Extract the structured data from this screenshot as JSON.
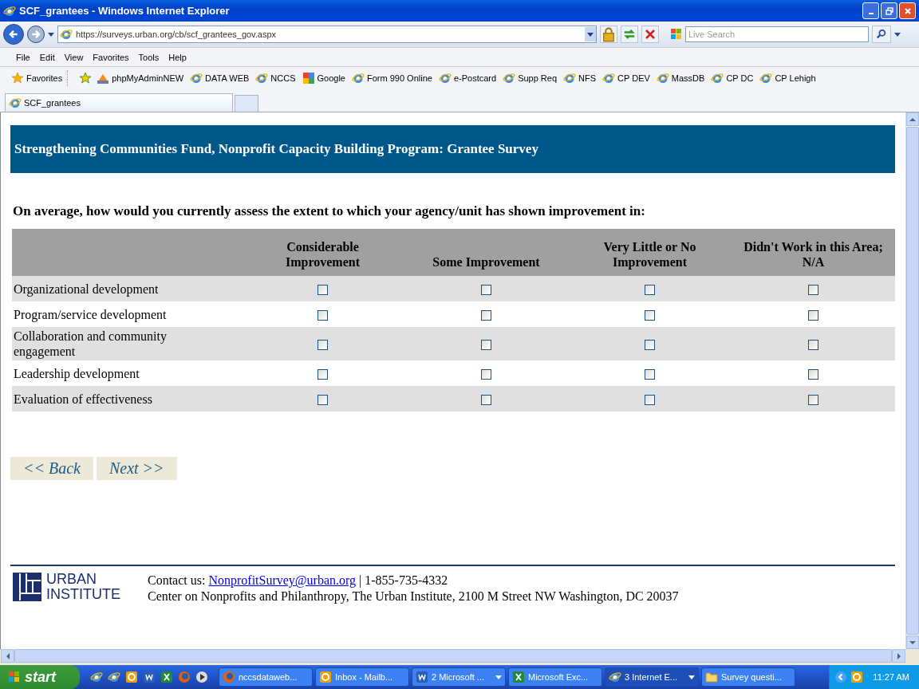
{
  "window": {
    "title": "SCF_grantees - Windows Internet Explorer"
  },
  "address_bar": {
    "url": "https://surveys.urban.org/cb/scf_grantees_gov.aspx"
  },
  "search": {
    "placeholder": "Live Search"
  },
  "menu": [
    "File",
    "Edit",
    "View",
    "Favorites",
    "Tools",
    "Help"
  ],
  "favorites_bar": {
    "label": "Favorites",
    "links": [
      {
        "label": "phpMyAdminNEW",
        "kind": "pma"
      },
      {
        "label": "DATA WEB",
        "kind": "ie"
      },
      {
        "label": "NCCS",
        "kind": "ie"
      },
      {
        "label": "Google",
        "kind": "google"
      },
      {
        "label": "Form 990 Online",
        "kind": "ie"
      },
      {
        "label": "e-Postcard",
        "kind": "ie"
      },
      {
        "label": "Supp Req",
        "kind": "ie"
      },
      {
        "label": "NFS",
        "kind": "ie"
      },
      {
        "label": "CP DEV",
        "kind": "ie"
      },
      {
        "label": "MassDB",
        "kind": "ie"
      },
      {
        "label": "CP DC",
        "kind": "ie"
      },
      {
        "label": "CP Lehigh",
        "kind": "ie"
      }
    ]
  },
  "tabs": [
    {
      "label": "SCF_grantees",
      "selected": true
    }
  ],
  "page": {
    "header": "Strengthening Communities Fund, Nonprofit Capacity Building Program: Grantee Survey",
    "question": "On average, how would you currently assess the extent to which your agency/unit has shown improvement in:",
    "columns": [
      "Considerable Improvement",
      "Some Improvement",
      "Very Little or No Improvement",
      "Didn't Work in this Area; N/A"
    ],
    "rows": [
      {
        "label": "Organizational development",
        "answers": [
          {
            "checked": false
          },
          {
            "checked": false
          },
          {
            "checked": false
          },
          {
            "checked": false
          }
        ]
      },
      {
        "label": "Program/service development",
        "answers": [
          {
            "checked": false
          },
          {
            "checked": false
          },
          {
            "checked": false
          },
          {
            "checked": false
          }
        ]
      },
      {
        "label": "Collaboration and community engagement",
        "answers": [
          {
            "checked": false
          },
          {
            "checked": false
          },
          {
            "checked": false
          },
          {
            "checked": false
          }
        ]
      },
      {
        "label": "Leadership development",
        "answers": [
          {
            "checked": false
          },
          {
            "checked": false
          },
          {
            "checked": false
          },
          {
            "checked": false
          }
        ]
      },
      {
        "label": "Evaluation of effectiveness",
        "answers": [
          {
            "checked": false
          },
          {
            "checked": false
          },
          {
            "checked": false
          },
          {
            "checked": false
          }
        ]
      }
    ],
    "buttons": [
      "<< Back",
      "Next >>"
    ],
    "footer": {
      "logo_lines": [
        "URBAN",
        "INSTITUTE"
      ],
      "contact_label": "Contact us:",
      "email": "NonprofitSurvey@urban.org",
      "phone": "| 1-855-735-4332",
      "address": "Center on Nonprofits and Philanthropy, The Urban Institute, 2100 M Street NW Washington, DC 20037"
    }
  },
  "taskbar": {
    "start": "start",
    "tasks": [
      {
        "label": "nccsdataweb...",
        "kind": "firefox",
        "grouped": false,
        "selected": false
      },
      {
        "label": "Inbox - Mailb...",
        "kind": "outlook",
        "grouped": false,
        "selected": false
      },
      {
        "label": "2 Microsoft ...",
        "kind": "word",
        "grouped": true,
        "selected": false
      },
      {
        "label": "Microsoft Exc...",
        "kind": "excel",
        "grouped": false,
        "selected": false
      },
      {
        "label": "3 Internet E...",
        "kind": "ie",
        "grouped": true,
        "selected": true
      },
      {
        "label": "Survey questi...",
        "kind": "folder",
        "grouped": false,
        "selected": false
      }
    ],
    "clock": "11:27 AM"
  }
}
